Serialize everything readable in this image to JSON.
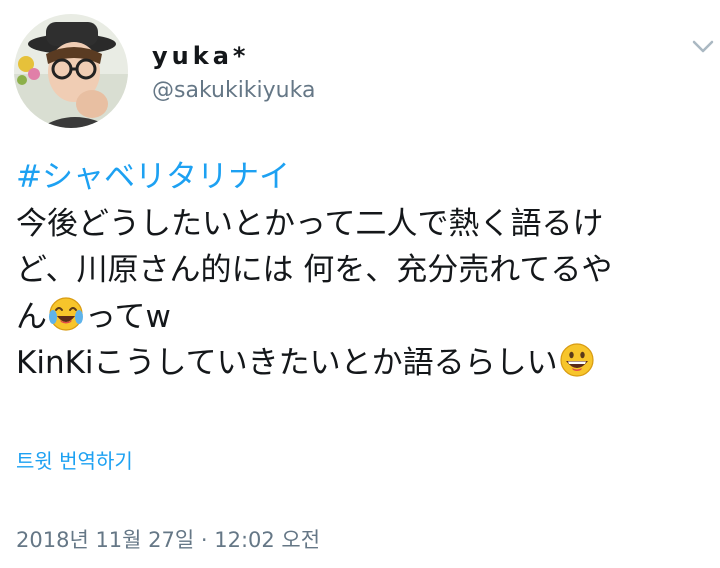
{
  "user": {
    "display_name": "yuka*",
    "handle": "@sakukikiyuka"
  },
  "tweet": {
    "hashtag": "#シャベリタリナイ",
    "line1": "今後どうしたいとかって二人で熱く語るけ",
    "line2": "ど、川原さん的には 何を、充分売れてるや",
    "line3a": "ん",
    "line3b": "ってw",
    "line4": "KinKiこうしていきたいとか語るらしい"
  },
  "translate_label": "트윗 번역하기",
  "timestamp": "2018년 11월 27일 · 12:02 오전",
  "icons": {
    "caret": "chevron-down-icon",
    "emoji1": "face-with-tears-of-joy",
    "emoji2": "grinning-face"
  },
  "colors": {
    "link": "#1da1f2",
    "secondary_text": "#657786",
    "primary_text": "#14171a"
  }
}
